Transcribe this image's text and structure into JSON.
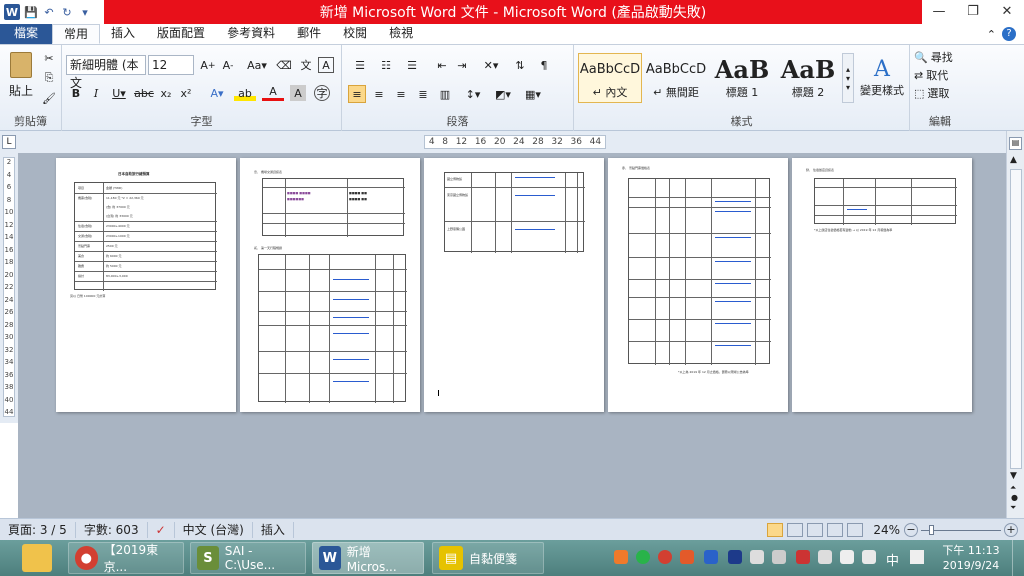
{
  "window": {
    "title": "新增 Microsoft Word 文件 - Microsoft Word (產品啟動失敗)",
    "title_color": "#e8101a"
  },
  "quick_access": [
    "save-icon",
    "undo-icon",
    "redo-icon",
    "customize-icon"
  ],
  "tabs": [
    "檔案",
    "常用",
    "插入",
    "版面配置",
    "參考資料",
    "郵件",
    "校閱",
    "檢視"
  ],
  "active_tab": "常用",
  "ribbon": {
    "clipboard": {
      "paste": "貼上",
      "label": "剪貼簿"
    },
    "font": {
      "name": "新細明體 (本文",
      "size": "12",
      "label": "字型"
    },
    "paragraph": {
      "label": "段落"
    },
    "styles": {
      "label": "樣式",
      "items": [
        {
          "preview": "AaBbCcD",
          "name": "↵ 內文"
        },
        {
          "preview": "AaBbCcD",
          "name": "↵ 無間距"
        },
        {
          "preview": "AaB",
          "name": "標題 1"
        },
        {
          "preview": "AaB",
          "name": "標題 2"
        }
      ],
      "change": "變更樣式"
    },
    "editing": {
      "find": "尋找",
      "replace": "取代",
      "select": "選取",
      "label": "編輯"
    }
  },
  "ruler": {
    "ticks": [
      "4",
      "8",
      "12",
      "16",
      "20",
      "24",
      "28",
      "32",
      "36",
      "44"
    ]
  },
  "vertical_ruler": [
    "2",
    "4",
    "6",
    "8",
    "10",
    "12",
    "14",
    "16",
    "18",
    "20",
    "22",
    "24",
    "26",
    "28",
    "30",
    "32",
    "34",
    "36",
    "38",
    "40",
    "44"
  ],
  "pages": {
    "p1": {
      "heading": "日本自助旅行總預算",
      "rows": [
        [
          "項目",
          "金額 (TWD)"
        ],
        [
          "機票(含稅)",
          "11,180 元 *2 = 22,360 元"
        ],
        [
          "",
          "(含) 約 37000 元"
        ],
        [
          "",
          "(台灣) 約 33000 元"
        ],
        [
          "住宿(含稅)",
          "23000+4000 元"
        ],
        [
          "交通(含稅)",
          "23000+1000 元"
        ],
        [
          "景點門票",
          "2500 元"
        ],
        [
          "美食",
          "約 6000 元"
        ],
        [
          "雜費",
          "約 5000 元"
        ],
        [
          "總計",
          "83,000+3,000"
        ]
      ],
      "note": "另以 日幣 100000 元計算"
    },
    "p2": {
      "heading1": "壹、 機場交通資訊表",
      "heading2": "貳、 第一天行程規劃"
    },
    "p3": {
      "rows": [
        "國立博物館",
        "東京國立博物館",
        "上野恩賜公園"
      ]
    },
    "p4": {
      "heading": "參、 景點門票價格表",
      "note": "*以上為 2019 年 12 月之價格，實際以現場公告為準"
    },
    "p5": {
      "heading": "肆、 住宿飯店資訊表",
      "note": "*以上飯店住宿價格若有變動 → 以 2019 年 12 月報價為準"
    }
  },
  "status": {
    "page": "頁面: 3 / 5",
    "words": "字數: 603",
    "language": "中文 (台灣)",
    "mode": "插入",
    "zoom": "24%"
  },
  "taskbar": {
    "items": [
      {
        "label": "【2019東京...",
        "icon": "chrome-icon",
        "color": "#d23f31"
      },
      {
        "label": "SAI - C:\\Use...",
        "icon": "sai-icon",
        "color": "#6a8e3a"
      },
      {
        "label": "新增 Micros...",
        "icon": "word-icon",
        "color": "#2b5797"
      },
      {
        "label": "自黏便箋",
        "icon": "sticky-notes-icon",
        "color": "#e6c200"
      }
    ],
    "ime": "中",
    "time": "下午 11:13",
    "date": "2019/9/24"
  }
}
